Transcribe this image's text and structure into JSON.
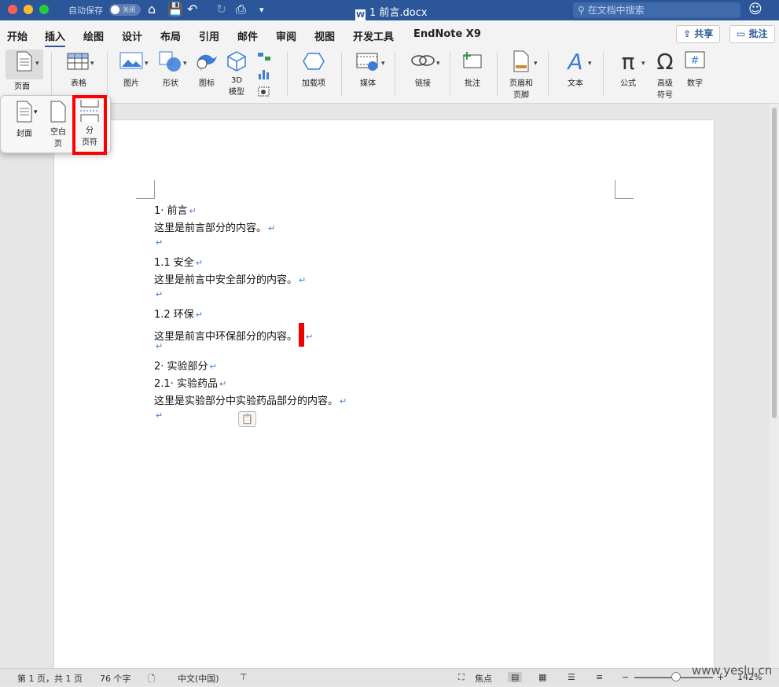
{
  "titlebar": {
    "autosave_label": "自动保存",
    "autosave_toggle": "关闭",
    "doc_title": "1 前言.docx",
    "doc_icon_letter": "W",
    "search_placeholder": "在文档中搜索"
  },
  "tabs": [
    "开始",
    "插入",
    "绘图",
    "设计",
    "布局",
    "引用",
    "邮件",
    "审阅",
    "视图",
    "开发工具",
    "EndNote X9"
  ],
  "active_tab": "插入",
  "share_label": "共享",
  "comment_label": "批注",
  "ribbon": {
    "page": "页面",
    "table": "表格",
    "picture": "图片",
    "shapes": "形状",
    "icons": "图标",
    "model3d_l1": "3D",
    "model3d_l2": "模型",
    "addins": "加载项",
    "media": "媒体",
    "link": "链接",
    "comment": "批注",
    "header_footer_l1": "页眉和",
    "header_footer_l2": "页脚",
    "text": "文本",
    "equation": "公式",
    "symbol_l1": "高级",
    "symbol_l2": "符号",
    "number": "数字"
  },
  "page_menu": {
    "cover": "封面",
    "blank_l1": "空白",
    "blank_l2": "页",
    "break_l1": "分",
    "break_l2": "页符"
  },
  "document": {
    "paragraphs": [
      "1· 前言",
      "这里是前言部分的内容。",
      "",
      "1.1 安全",
      "这里是前言中安全部分的内容。",
      "",
      "1.2 环保",
      "这里是前言中环保部分的内容。",
      "",
      "2· 实验部分",
      "2.1· 实验药品",
      "这里是实验部分中实验药品部分的内容。",
      ""
    ],
    "paragraph_mark": "↵"
  },
  "statusbar": {
    "page_info": "第 1 页，共 1 页",
    "word_count": "76 个字",
    "language": "中文(中国)",
    "focus": "焦点",
    "zoom": "142%"
  },
  "watermark": "www.yeslu.cn",
  "colors": {
    "titlebar": "#2b579a",
    "highlight": "#ff0000",
    "cursor": "#ee0000",
    "para_mark": "#3b7dd8"
  }
}
